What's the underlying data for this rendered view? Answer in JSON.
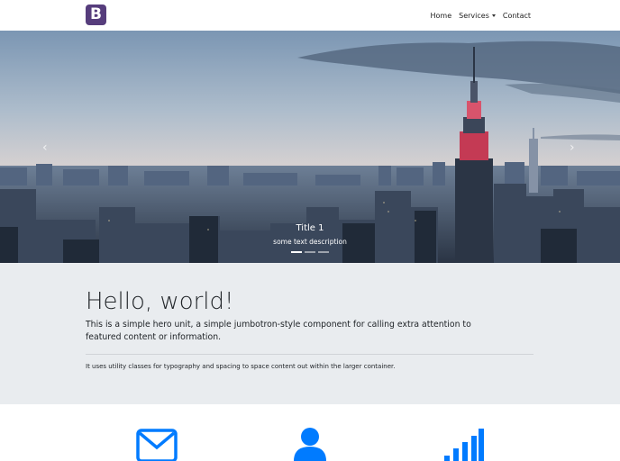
{
  "brand": {
    "letter": "B",
    "color": "#563d7c"
  },
  "nav": {
    "items": [
      "Home",
      "Services",
      "Contact"
    ]
  },
  "carousel": {
    "caption_title": "Title 1",
    "caption_text": "some text description",
    "slides": 3,
    "active_slide": 1,
    "prev_icon": "chevron-left-icon",
    "next_icon": "chevron-right-icon"
  },
  "jumbotron": {
    "heading": "Hello, world!",
    "lead": "This is a simple hero unit, a simple jumbotron-style component for calling extra attention to featured content or information.",
    "text": "It uses utility classes for typography and spacing to space content out within the larger container."
  },
  "features": {
    "icons": [
      "envelope-icon",
      "user-icon",
      "signal-bars-icon"
    ],
    "color": "#007bff"
  }
}
